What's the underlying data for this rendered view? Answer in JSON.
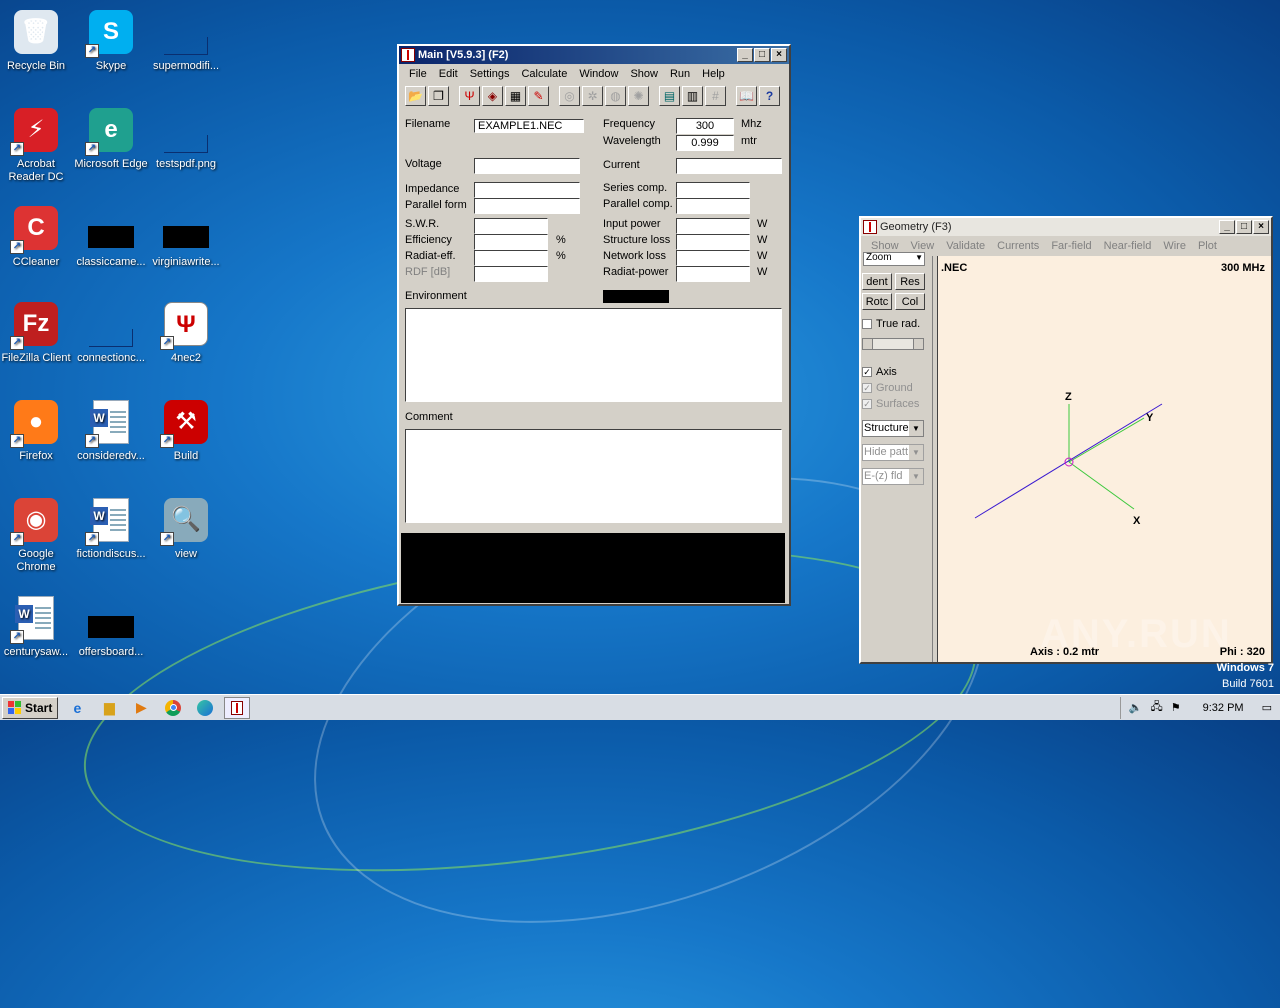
{
  "desktop": {
    "icons": [
      {
        "label": "Recycle Bin",
        "icon": "recycle-bin-icon"
      },
      {
        "label": "Skype",
        "icon": "skype-icon"
      },
      {
        "label": "supermodifi...",
        "icon": "file-icon"
      },
      {
        "label": "Acrobat Reader DC",
        "icon": "acrobat-icon"
      },
      {
        "label": "Microsoft Edge",
        "icon": "edge-icon"
      },
      {
        "label": "testspdf.png",
        "icon": "file-icon"
      },
      {
        "label": "CCleaner",
        "icon": "ccleaner-icon"
      },
      {
        "label": "classiccame...",
        "icon": "file-icon"
      },
      {
        "label": "virginiawrite...",
        "icon": "file-icon"
      },
      {
        "label": "FileZilla Client",
        "icon": "filezilla-icon"
      },
      {
        "label": "connectionc...",
        "icon": "file-icon"
      },
      {
        "label": "4nec2",
        "icon": "4nec2-icon"
      },
      {
        "label": "Firefox",
        "icon": "firefox-icon"
      },
      {
        "label": "consideredv...",
        "icon": "word-icon"
      },
      {
        "label": "Build",
        "icon": "build-icon"
      },
      {
        "label": "Google Chrome",
        "icon": "chrome-icon"
      },
      {
        "label": "fictiondiscus...",
        "icon": "word-icon"
      },
      {
        "label": "view",
        "icon": "view-icon"
      },
      {
        "label": "centurysaw...",
        "icon": "word-icon"
      },
      {
        "label": "offersboard...",
        "icon": "file-icon"
      }
    ]
  },
  "main_window": {
    "title": "Main [V5.9.3]  (F2)",
    "menu": [
      "File",
      "Edit",
      "Settings",
      "Calculate",
      "Window",
      "Show",
      "Run",
      "Help"
    ],
    "filename_label": "Filename",
    "filename_value": "EXAMPLE1.NEC",
    "frequency_label": "Frequency",
    "frequency_value": "300",
    "frequency_unit": "Mhz",
    "wavelength_label": "Wavelength",
    "wavelength_value": "0.999",
    "wavelength_unit": "mtr",
    "voltage_label": "Voltage",
    "current_label": "Current",
    "impedance_label": "Impedance",
    "series_comp_label": "Series comp.",
    "parallel_form_label": "Parallel form",
    "parallel_comp_label": "Parallel comp.",
    "swr_label": "S.W.R.",
    "input_power_label": "Input power",
    "efficiency_label": "Efficiency",
    "structure_loss_label": "Structure loss",
    "radiat_eff_label": "Radiat-eff.",
    "network_loss_label": "Network loss",
    "rdf_label": "RDF [dB]",
    "radiat_power_label": "Radiat-power",
    "percent_unit": "%",
    "watt_unit": "W",
    "environment_label": "Environment",
    "comment_label": "Comment"
  },
  "geometry_window": {
    "title": "Geometry   (F3)",
    "menu": [
      "Show",
      "View",
      "Validate",
      "Currents",
      "Far-field",
      "Near-field",
      "Wire",
      "Plot"
    ],
    "zoom_label": "Zoom",
    "buttons": [
      "dent",
      "Res",
      "Rotc",
      "Col"
    ],
    "true_rad_label": "True rad.",
    "axis_label": "Axis",
    "ground_label": "Ground",
    "surfaces_label": "Surfaces",
    "structure_select": "Structure",
    "hide_patt_select": "Hide patt.",
    "ez_fld_select": "E-(z) fld",
    "file_label": ".NEC",
    "freq_label": "300 MHz",
    "axis_x": "X",
    "axis_y": "Y",
    "axis_z": "Z",
    "axis_info": "Axis : 0.2 mtr",
    "phi_info": "Phi : 320"
  },
  "watermark": {
    "text": "ANY.RUN",
    "os_name": "Windows 7",
    "os_build": "Build 7601"
  },
  "taskbar": {
    "start_label": "Start",
    "clock": "9:32 PM"
  }
}
